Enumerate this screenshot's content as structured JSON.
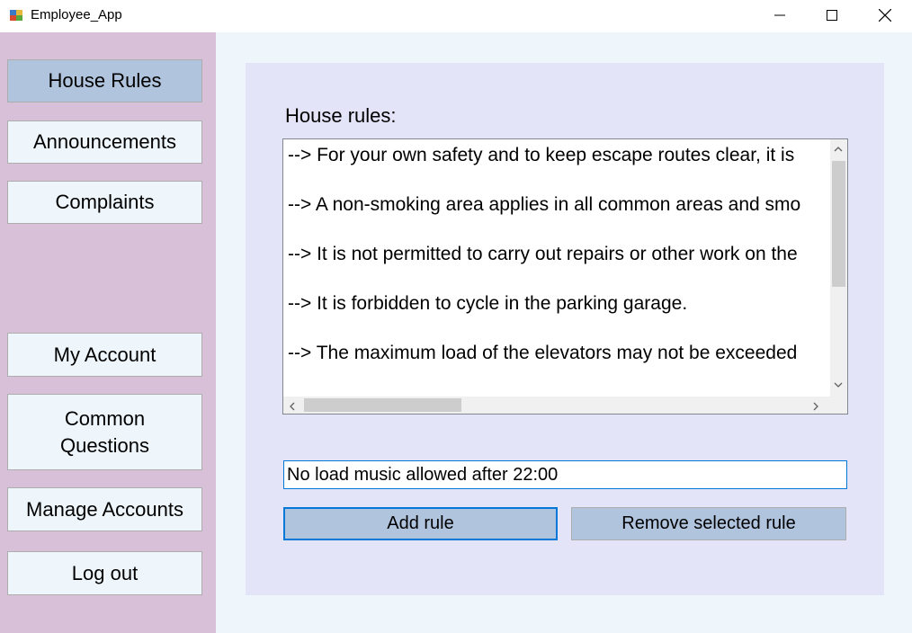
{
  "window": {
    "title": "Employee_App",
    "controls": {
      "minimize": "minimize-icon",
      "maximize": "maximize-icon",
      "close": "close-icon"
    }
  },
  "sidebar": {
    "items": [
      {
        "label": "House Rules",
        "active": true
      },
      {
        "label": "Announcements",
        "active": false
      },
      {
        "label": "Complaints",
        "active": false
      },
      {
        "label": "My Account",
        "active": false
      },
      {
        "label": "Common Questions",
        "lines": [
          "Common",
          "Questions"
        ],
        "active": false
      },
      {
        "label": "Manage Accounts",
        "active": false
      },
      {
        "label": "Log out",
        "active": false
      }
    ]
  },
  "main": {
    "rules_label": "House rules:",
    "rules": [
      "--> For your own safety and to keep escape routes clear, it is",
      "--> A non-smoking area applies in all common areas and smo",
      "--> It is not permitted to carry out repairs or other work on the",
      "--> It is forbidden to cycle in the parking garage.",
      "--> The maximum load of the elevators may not be exceeded"
    ],
    "new_rule_value": "No load music allowed after 22:00",
    "add_rule_label": "Add rule",
    "remove_rule_label": "Remove selected rule"
  },
  "colors": {
    "sidebar_bg": "#d8c0d8",
    "active_nav": "#b0c4de",
    "panel_bg": "#e4e4f8",
    "main_bg": "#eef6fc",
    "focus_border": "#0078d7"
  }
}
